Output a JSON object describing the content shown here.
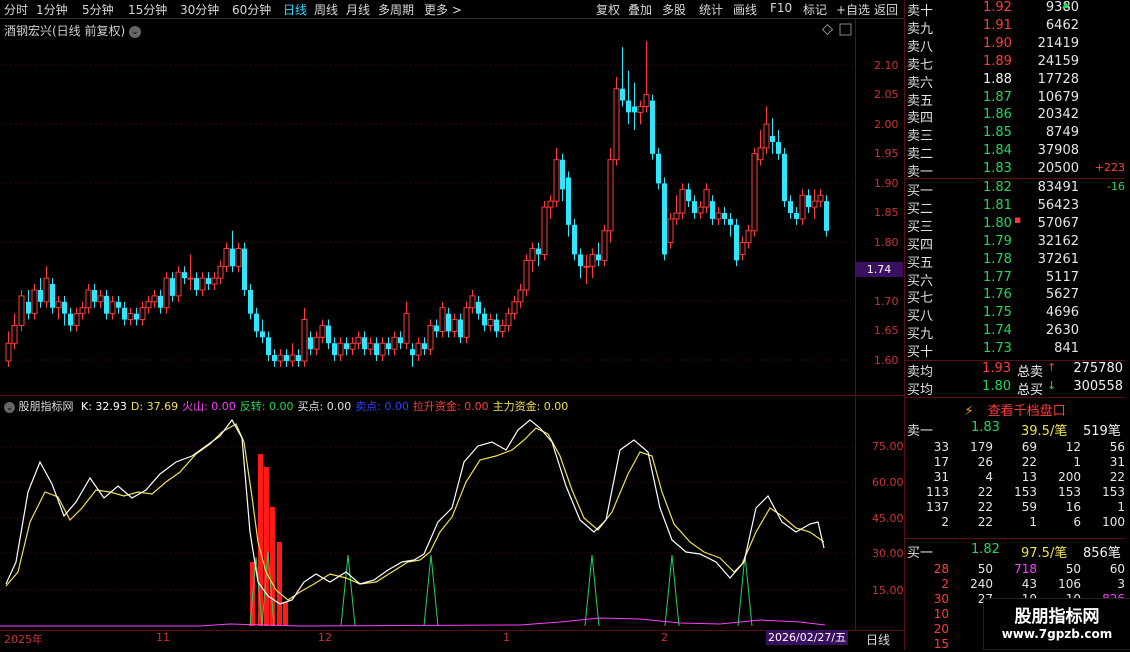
{
  "toolbar": {
    "items": [
      "分时",
      "1分钟",
      "5分钟",
      "15分钟",
      "30分钟",
      "60分钟",
      "日线",
      "周线",
      "月线",
      "多周期",
      "更多 >"
    ],
    "active_index": 6,
    "right_items": [
      "复权",
      "叠加",
      "多股",
      "统计",
      "画线",
      "F10",
      "标记",
      "+自选",
      "返回"
    ]
  },
  "main_chart": {
    "title": "酒钢宏兴(日线 前复权)",
    "price_axis": [
      "2.10",
      "2.05",
      "2.00",
      "1.95",
      "1.90",
      "1.85",
      "1.80",
      "1.70",
      "1.65",
      "1.60"
    ],
    "current_price": "1.74",
    "colors": {
      "up": "#ff3b3b",
      "down": "#2fe6ff"
    }
  },
  "indicator": {
    "name": "股朋指标网",
    "fields": [
      {
        "label": "K: 32.93",
        "color": "#ffffff"
      },
      {
        "label": "D: 37.69",
        "color": "#f0e050"
      },
      {
        "label": "火山: 0.00",
        "color": "#ff3dff"
      },
      {
        "label": "反转: 0.00",
        "color": "#25d55a"
      },
      {
        "label": "买点: 0.00",
        "color": "#e0e0e0"
      },
      {
        "label": "卖点: 0.00",
        "color": "#3040ff"
      },
      {
        "label": "拉升资金: 0.00",
        "color": "#ff3b3b"
      },
      {
        "label": "主力资金: 0.00",
        "color": "#f0e050"
      }
    ],
    "axis": [
      "75.00",
      "60.00",
      "45.00",
      "30.00",
      "15.00"
    ]
  },
  "date_axis": {
    "labels": [
      "2025年",
      "11",
      "12",
      "1",
      "2"
    ],
    "current_date": "2026/02/27/五",
    "period": "日线"
  },
  "order_book": {
    "sells": [
      {
        "label": "卖十",
        "price": "1.92",
        "vol": "9380",
        "extra": "▲"
      },
      {
        "label": "卖九",
        "price": "1.91",
        "vol": "6462",
        "extra": ""
      },
      {
        "label": "卖八",
        "price": "1.90",
        "vol": "21419",
        "extra": ""
      },
      {
        "label": "卖七",
        "price": "1.89",
        "vol": "24159",
        "extra": ""
      },
      {
        "label": "卖六",
        "price": "1.88",
        "vol": "17728",
        "extra": ""
      },
      {
        "label": "卖五",
        "price": "1.87",
        "vol": "10679",
        "extra": ""
      },
      {
        "label": "卖四",
        "price": "1.86",
        "vol": "20342",
        "extra": ""
      },
      {
        "label": "卖三",
        "price": "1.85",
        "vol": "8749",
        "extra": ""
      },
      {
        "label": "卖二",
        "price": "1.84",
        "vol": "37908",
        "extra": ""
      },
      {
        "label": "卖一",
        "price": "1.83",
        "vol": "20500",
        "extra": "+223"
      }
    ],
    "buys": [
      {
        "label": "买一",
        "price": "1.82",
        "vol": "83491",
        "extra": "-16"
      },
      {
        "label": "买二",
        "price": "1.81",
        "vol": "56423",
        "extra": ""
      },
      {
        "label": "买三",
        "price": "1.80",
        "vol": "57067",
        "extra": "■"
      },
      {
        "label": "买四",
        "price": "1.79",
        "vol": "32162",
        "extra": ""
      },
      {
        "label": "买五",
        "price": "1.78",
        "vol": "37261",
        "extra": ""
      },
      {
        "label": "买六",
        "price": "1.77",
        "vol": "5117",
        "extra": ""
      },
      {
        "label": "买七",
        "price": "1.76",
        "vol": "5627",
        "extra": ""
      },
      {
        "label": "买八",
        "price": "1.75",
        "vol": "4696",
        "extra": ""
      },
      {
        "label": "买九",
        "price": "1.74",
        "vol": "2630",
        "extra": ""
      },
      {
        "label": "买十",
        "price": "1.73",
        "vol": "841",
        "extra": ""
      }
    ],
    "avg_sell": {
      "label": "卖均",
      "price": "1.93",
      "total_label": "总卖",
      "arrow": "↑",
      "total": "275780"
    },
    "avg_buy": {
      "label": "买均",
      "price": "1.80",
      "total_label": "总买",
      "arrow": "↓",
      "total": "300558"
    }
  },
  "level_panel": {
    "button": "查看千档盘口",
    "sell1": {
      "label": "卖一",
      "price": "1.83",
      "avg": "39.5/笔",
      "count": "519笔"
    },
    "sell_grid": [
      [
        "33",
        "179",
        "69",
        "12",
        "56"
      ],
      [
        "17",
        "26",
        "22",
        "1",
        "31"
      ],
      [
        "31",
        "4",
        "13",
        "200",
        "22"
      ],
      [
        "113",
        "22",
        "153",
        "153",
        "153"
      ],
      [
        "137",
        "22",
        "59",
        "16",
        "1"
      ],
      [
        "2",
        "22",
        "1",
        "6",
        "100"
      ]
    ],
    "buy1": {
      "label": "买一",
      "price": "1.82",
      "avg": "97.5/笔",
      "count": "856笔"
    },
    "buy_grid": [
      [
        "28",
        "50",
        "718",
        "50",
        "60"
      ],
      [
        "2",
        "240",
        "43",
        "106",
        "3"
      ],
      [
        "30",
        "27",
        "10",
        "10",
        "826"
      ],
      [
        "10"
      ],
      [
        "20"
      ],
      [
        "15"
      ]
    ]
  },
  "watermark": {
    "title": "股朋指标网",
    "url": "www.7gpzb.com"
  }
}
